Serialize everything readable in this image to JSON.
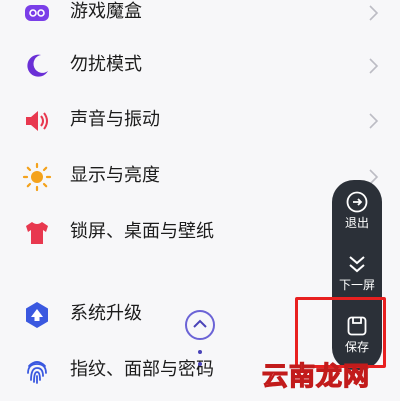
{
  "settings": {
    "items": [
      {
        "label": "游戏魔盒",
        "icon": "game-box-icon",
        "color": "#7a3ee8"
      },
      {
        "label": "勿扰模式",
        "icon": "moon-icon",
        "color": "#6a2fd6"
      },
      {
        "label": "声音与振动",
        "icon": "speaker-icon",
        "color": "#e8384f"
      },
      {
        "label": "显示与亮度",
        "icon": "sun-icon",
        "color": "#f4a21c"
      },
      {
        "label": "锁屏、桌面与壁纸",
        "icon": "shirt-icon",
        "color": "#e8384f"
      },
      {
        "label": "系统升级",
        "icon": "update-icon",
        "color": "#3a58e0"
      },
      {
        "label": "指纹、面部与密码",
        "icon": "fingerprint-icon",
        "color": "#3a58e0"
      }
    ]
  },
  "toolbar": {
    "exit_label": "退出",
    "next_screen_label": "下一屏",
    "save_label": "保存"
  },
  "watermark": "云南龙网",
  "colors": {
    "toolbar_bg": "#2b3038",
    "highlight": "#e82020",
    "accent": "#6b63d6"
  }
}
